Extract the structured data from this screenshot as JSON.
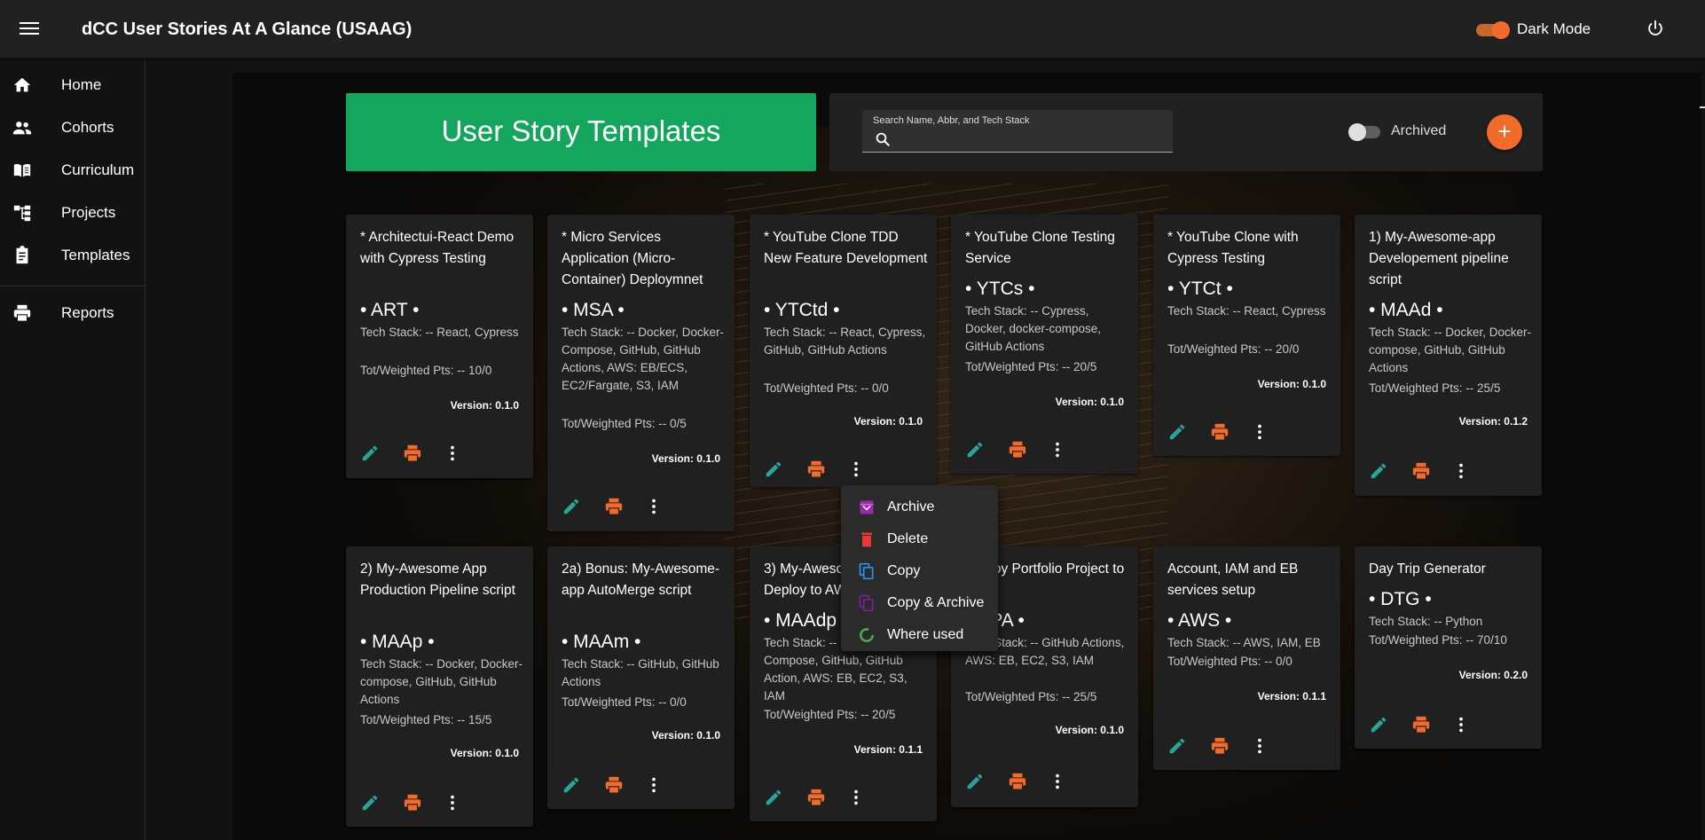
{
  "app": {
    "title": "dCC User Stories At A Glance (USAAG)",
    "dark_mode_label": "Dark Mode"
  },
  "nav": {
    "items": [
      {
        "label": "Home",
        "icon": "home-icon"
      },
      {
        "label": "Cohorts",
        "icon": "people-icon"
      },
      {
        "label": "Curriculum",
        "icon": "book-icon"
      },
      {
        "label": "Projects",
        "icon": "tree-icon"
      },
      {
        "label": "Templates",
        "icon": "clipboard-icon"
      },
      {
        "label": "Reports",
        "icon": "print-icon"
      }
    ]
  },
  "page": {
    "heading": "User Story Templates"
  },
  "search": {
    "label": "Search Name, Abbr, and Tech Stack",
    "value": ""
  },
  "archived": {
    "label": "Archived",
    "on": false
  },
  "add_button": {
    "label": "+"
  },
  "colors": {
    "accent": "#f26b2a",
    "banner": "#13a65c",
    "edit": "#26a69a",
    "archive": "#9c27b0",
    "delete": "#e53935",
    "copy": "#2196f3",
    "where_used": "#4caf50"
  },
  "cards": [
    {
      "title": "* Architectui-React Demo with Cypress Testing",
      "abbr": "• ART •",
      "stack": "Tech Stack: -- React, Cypress",
      "points": "Tot/Weighted Pts: -- 10/0",
      "version": "Version: 0.1.0"
    },
    {
      "title": "* Micro Services Application (Micro-Container) Deploymnet",
      "abbr": "• MSA •",
      "stack": "Tech Stack: -- Docker, Docker-Compose, GitHub, GitHub Actions, AWS: EB/ECS, EC2/Fargate, S3, IAM",
      "points": "Tot/Weighted Pts: -- 0/5",
      "version": "Version: 0.1.0"
    },
    {
      "title": "* YouTube Clone TDD New Feature Development",
      "abbr": "• YTCtd •",
      "stack": "Tech Stack: -- React, Cypress, GitHub, GitHub Actions",
      "points": "Tot/Weighted Pts: -- 0/0",
      "version": "Version: 0.1.0"
    },
    {
      "title": "* YouTube Clone Testing Service",
      "abbr": "• YTCs •",
      "stack": "Tech Stack: -- Cypress, Docker, docker-compose, GitHub Actions",
      "points": "Tot/Weighted Pts: -- 20/5",
      "version": "Version: 0.1.0"
    },
    {
      "title": "* YouTube Clone with Cypress Testing",
      "abbr": "• YTCt •",
      "stack": "Tech Stack: -- React, Cypress",
      "points": "Tot/Weighted Pts: -- 20/0",
      "version": "Version: 0.1.0"
    },
    {
      "title": "1) My-Awesome-app Developement pipeline script",
      "abbr": "• MAAd •",
      "stack": "Tech Stack: -- Docker, Docker-compose, GitHub, GitHub Actions",
      "points": "Tot/Weighted Pts: -- 25/5",
      "version": "Version: 0.1.2"
    },
    {
      "title": "2) My-Awesome App Production Pipeline script",
      "abbr": "• MAAp •",
      "stack": "Tech Stack: -- Docker, Docker-compose, GitHub, GitHub Actions",
      "points": "Tot/Weighted Pts: -- 15/5",
      "version": "Version: 0.1.0"
    },
    {
      "title": "2a) Bonus: My-Awesome-app AutoMerge script",
      "abbr": "• MAAm •",
      "stack": "Tech Stack: -- GitHub, GitHub Actions",
      "points": "Tot/Weighted Pts: -- 0/0",
      "version": "Version: 0.1.0"
    },
    {
      "title": "3) My-Awesome-app Deploy to AWS",
      "abbr": "• MAAdp •",
      "stack": "Tech Stack: -- Docker, Docker-Compose, GitHub, GitHub Action, AWS: EB, EC2, S3, IAM",
      "points": "Tot/Weighted Pts: -- 20/5",
      "version": "Version: 0.1.1"
    },
    {
      "title": "Deploy Portfolio Project to AWS",
      "abbr": "• DPA •",
      "stack": "Tech Stack: -- GitHub Actions, AWS: EB, EC2, S3, IAM",
      "points": "Tot/Weighted Pts: -- 25/5",
      "version": "Version: 0.1.0"
    },
    {
      "title": "Account, IAM and EB services setup",
      "abbr": "• AWS •",
      "stack": "Tech Stack: -- AWS, IAM, EB",
      "points": "Tot/Weighted Pts: -- 0/0",
      "version": "Version: 0.1.1"
    },
    {
      "title": "Day Trip Generator",
      "abbr": "• DTG •",
      "stack": "Tech Stack: -- Python",
      "points": "Tot/Weighted Pts: -- 70/10",
      "version": "Version: 0.2.0"
    }
  ],
  "context_menu": {
    "items": [
      {
        "label": "Archive",
        "icon": "archive-icon"
      },
      {
        "label": "Delete",
        "icon": "delete-icon"
      },
      {
        "label": "Copy",
        "icon": "copy-icon"
      },
      {
        "label": "Copy & Archive",
        "icon": "copy-archive-icon"
      },
      {
        "label": "Where used",
        "icon": "where-used-icon"
      }
    ]
  }
}
